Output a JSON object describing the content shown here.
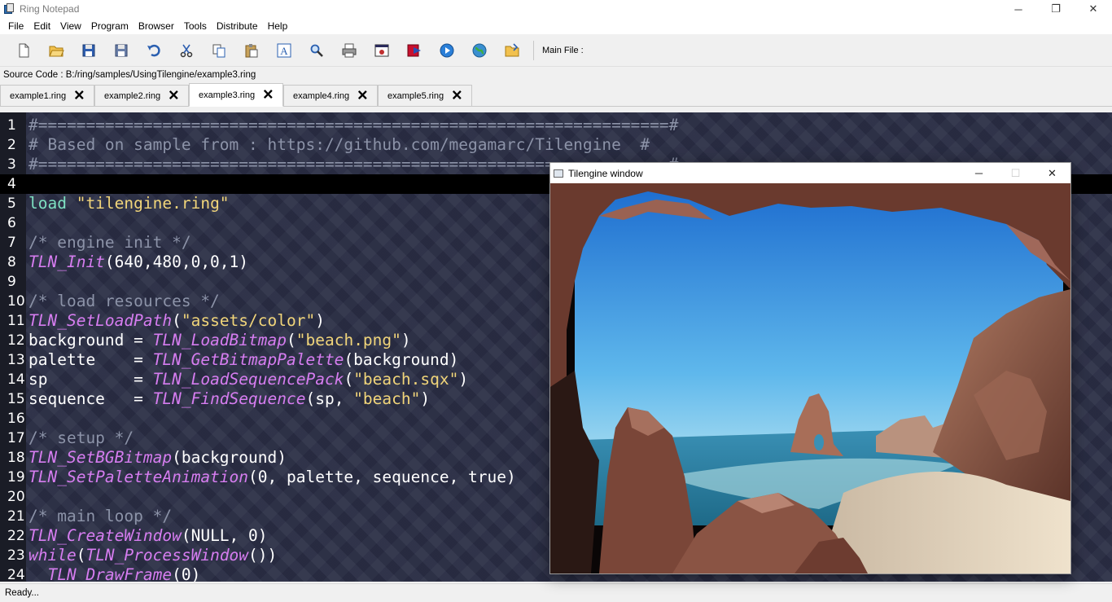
{
  "window": {
    "title": "Ring Notepad",
    "controls": {
      "minimize": "─",
      "restore": "❐",
      "close": "✕"
    }
  },
  "menu": [
    "File",
    "Edit",
    "View",
    "Program",
    "Browser",
    "Tools",
    "Distribute",
    "Help"
  ],
  "toolbar": {
    "icons": [
      "new-file-icon",
      "open-folder-icon",
      "save-icon",
      "save-as-icon",
      "undo-icon",
      "cut-icon",
      "copy-icon",
      "paste-icon",
      "font-icon",
      "find-icon",
      "print-icon",
      "debug-icon",
      "run-icon",
      "run-gui-icon",
      "web-browser-icon",
      "set-main-file-icon"
    ],
    "main_file_label": "Main File :"
  },
  "source_code_label": "Source Code : B:/ring/samples/UsingTilengine/example3.ring",
  "tabs": [
    {
      "label": "example1.ring",
      "active": false
    },
    {
      "label": "example2.ring",
      "active": false
    },
    {
      "label": "example3.ring",
      "active": true
    },
    {
      "label": "example4.ring",
      "active": false
    },
    {
      "label": "example5.ring",
      "active": false
    }
  ],
  "tab_close_glyph": "🗙",
  "editor": {
    "current_line": 4,
    "colors": {
      "background": "#2a2e45",
      "comment": "#8c93a8",
      "keyword": "#7ee1c2",
      "string": "#f1d57a",
      "function": "#d67df0",
      "text": "#ffffff"
    },
    "lines": [
      {
        "n": "1",
        "parts": [
          {
            "t": "#==================================================================#",
            "c": "comment"
          }
        ]
      },
      {
        "n": "2",
        "parts": [
          {
            "t": "# Based on sample from : https://github.com/megamarc/Tilengine  #",
            "c": "comment"
          }
        ]
      },
      {
        "n": "3",
        "parts": [
          {
            "t": "#==================================================================#",
            "c": "comment"
          }
        ]
      },
      {
        "n": "4",
        "parts": []
      },
      {
        "n": "5",
        "parts": [
          {
            "t": "load ",
            "c": "kw"
          },
          {
            "t": "\"tilengine.ring\"",
            "c": "str"
          }
        ]
      },
      {
        "n": "6",
        "parts": []
      },
      {
        "n": "7",
        "parts": [
          {
            "t": "/* engine init */",
            "c": "comment"
          }
        ]
      },
      {
        "n": "8",
        "parts": [
          {
            "t": "TLN_Init",
            "c": "fn"
          },
          {
            "t": "(640,480,0,0,1)",
            "c": "plain"
          }
        ]
      },
      {
        "n": "9",
        "parts": []
      },
      {
        "n": "10",
        "parts": [
          {
            "t": "/* load resources */",
            "c": "comment"
          }
        ]
      },
      {
        "n": "11",
        "parts": [
          {
            "t": "TLN_SetLoadPath",
            "c": "fn"
          },
          {
            "t": "(",
            "c": "plain"
          },
          {
            "t": "\"assets/color\"",
            "c": "str"
          },
          {
            "t": ")",
            "c": "plain"
          }
        ]
      },
      {
        "n": "12",
        "parts": [
          {
            "t": "background = ",
            "c": "plain"
          },
          {
            "t": "TLN_LoadBitmap",
            "c": "fn"
          },
          {
            "t": "(",
            "c": "plain"
          },
          {
            "t": "\"beach.png\"",
            "c": "str"
          },
          {
            "t": ")",
            "c": "plain"
          }
        ]
      },
      {
        "n": "13",
        "parts": [
          {
            "t": "palette    = ",
            "c": "plain"
          },
          {
            "t": "TLN_GetBitmapPalette",
            "c": "fn"
          },
          {
            "t": "(background)",
            "c": "plain"
          }
        ]
      },
      {
        "n": "14",
        "parts": [
          {
            "t": "sp         = ",
            "c": "plain"
          },
          {
            "t": "TLN_LoadSequencePack",
            "c": "fn"
          },
          {
            "t": "(",
            "c": "plain"
          },
          {
            "t": "\"beach.sqx\"",
            "c": "str"
          },
          {
            "t": ")",
            "c": "plain"
          }
        ]
      },
      {
        "n": "15",
        "parts": [
          {
            "t": "sequence   = ",
            "c": "plain"
          },
          {
            "t": "TLN_FindSequence",
            "c": "fn"
          },
          {
            "t": "(sp, ",
            "c": "plain"
          },
          {
            "t": "\"beach\"",
            "c": "str"
          },
          {
            "t": ")",
            "c": "plain"
          }
        ]
      },
      {
        "n": "16",
        "parts": []
      },
      {
        "n": "17",
        "parts": [
          {
            "t": "/* setup */",
            "c": "comment"
          }
        ]
      },
      {
        "n": "18",
        "parts": [
          {
            "t": "TLN_SetBGBitmap",
            "c": "fn"
          },
          {
            "t": "(background)",
            "c": "plain"
          }
        ]
      },
      {
        "n": "19",
        "parts": [
          {
            "t": "TLN_SetPaletteAnimation",
            "c": "fn"
          },
          {
            "t": "(0, palette, sequence, true)",
            "c": "plain"
          }
        ]
      },
      {
        "n": "20",
        "parts": []
      },
      {
        "n": "21",
        "parts": [
          {
            "t": "/* main loop */",
            "c": "comment"
          }
        ]
      },
      {
        "n": "22",
        "parts": [
          {
            "t": "TLN_CreateWindow",
            "c": "fn"
          },
          {
            "t": "(NULL, 0)",
            "c": "plain"
          }
        ]
      },
      {
        "n": "23",
        "parts": [
          {
            "t": "while",
            "c": "fn"
          },
          {
            "t": "(",
            "c": "plain"
          },
          {
            "t": "TLN_ProcessWindow",
            "c": "fn"
          },
          {
            "t": "())",
            "c": "plain"
          }
        ]
      },
      {
        "n": "24",
        "parts": [
          {
            "t": "  ",
            "c": "plain"
          },
          {
            "t": "TLN_DrawFrame",
            "c": "fn"
          },
          {
            "t": "(0)",
            "c": "plain"
          }
        ]
      }
    ]
  },
  "status": "Ready...",
  "tilengine_window": {
    "title": "Tilengine window",
    "controls": {
      "minimize": "─",
      "maximize": "☐",
      "close": "✕"
    },
    "scene": "beach-cave-image",
    "colors": {
      "sky_top": "#1f6fd0",
      "sky_bottom": "#8fd0ee",
      "sea": "#2a87a8",
      "rock": "#8a5a4a",
      "rock_dark": "#4a2a22",
      "sand": "#e8d8c0"
    }
  }
}
